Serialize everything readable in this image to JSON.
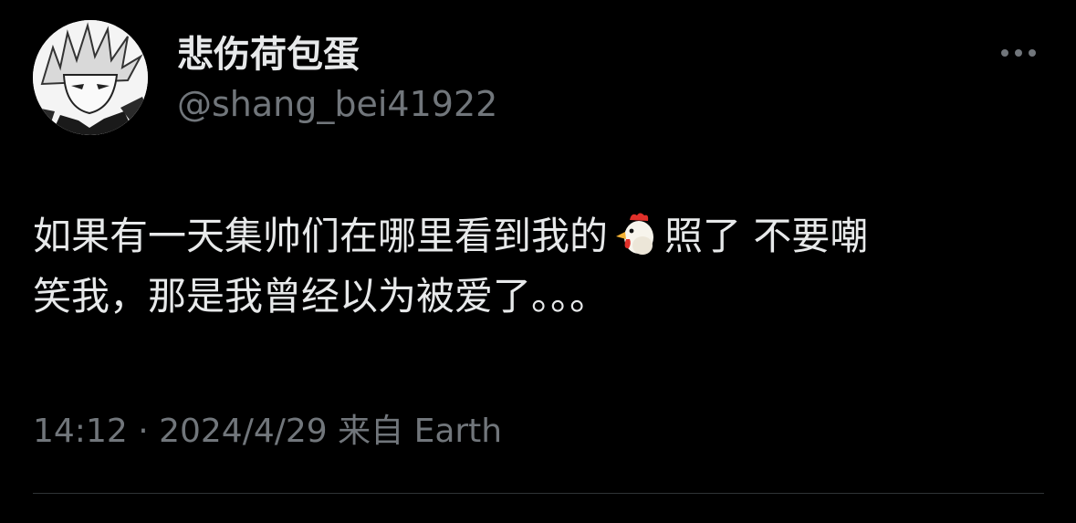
{
  "author": {
    "display_name": "悲伤荷包蛋",
    "handle": "@shang_bei41922"
  },
  "tweet": {
    "line1_before_emoji": "如果有一天集帅们在哪里看到我的",
    "emoji_icon": "chicken-icon",
    "line1_after_emoji": "照了 不要嘲",
    "line2": "笑我，那是我曾经以为被爱了。。。"
  },
  "meta": {
    "time": "14:12",
    "separator": " · ",
    "date": "2024/4/29",
    "source": " 来自 Earth"
  },
  "colors": {
    "background": "#000000",
    "primary_text": "#e7e9ea",
    "secondary_text": "#71767b",
    "divider": "#2f3336"
  }
}
